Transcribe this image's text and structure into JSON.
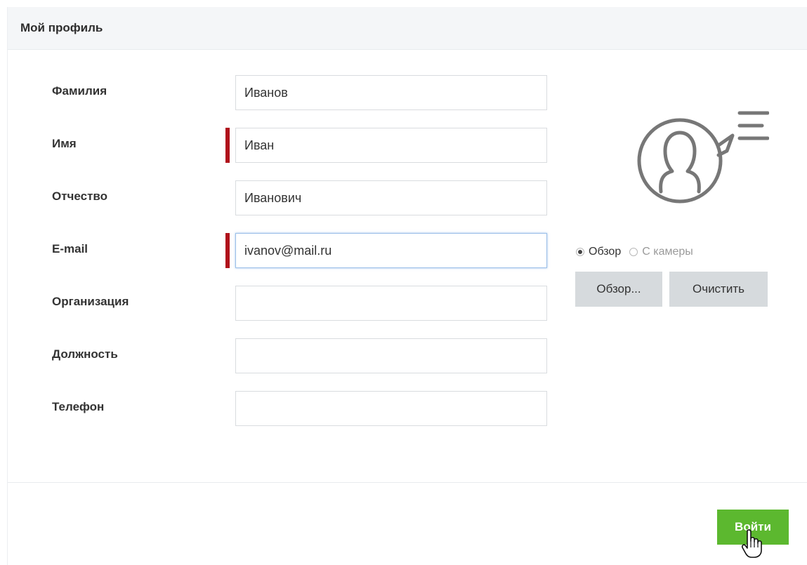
{
  "panel": {
    "title": "Мой профиль"
  },
  "form": {
    "fields": [
      {
        "label": "Фамилия",
        "value": "Иванов",
        "required": false
      },
      {
        "label": "Имя",
        "value": "Иван",
        "required": true
      },
      {
        "label": "Отчество",
        "value": "Иванович",
        "required": false
      },
      {
        "label": "E-mail",
        "value": "ivanov@mail.ru",
        "required": true,
        "focused": true
      },
      {
        "label": "Организация",
        "value": "",
        "required": false
      },
      {
        "label": "Должность",
        "value": "",
        "required": false
      },
      {
        "label": "Телефон",
        "value": "",
        "required": false
      }
    ]
  },
  "photo": {
    "avatar_icon": "user-speech-icon",
    "source_options": [
      {
        "label": "Обзор",
        "selected": true
      },
      {
        "label": "С камеры",
        "selected": false
      }
    ],
    "browse_label": "Обзор...",
    "clear_label": "Очистить"
  },
  "footer": {
    "submit_label": "Войти",
    "cursor_icon": "hand-pointer-icon"
  },
  "colors": {
    "required_marker": "#b0121b",
    "submit_button": "#5cb82f",
    "secondary_button": "#d6dadd",
    "header_background": "#f4f6f8",
    "focus_border": "#9bbfe8"
  }
}
